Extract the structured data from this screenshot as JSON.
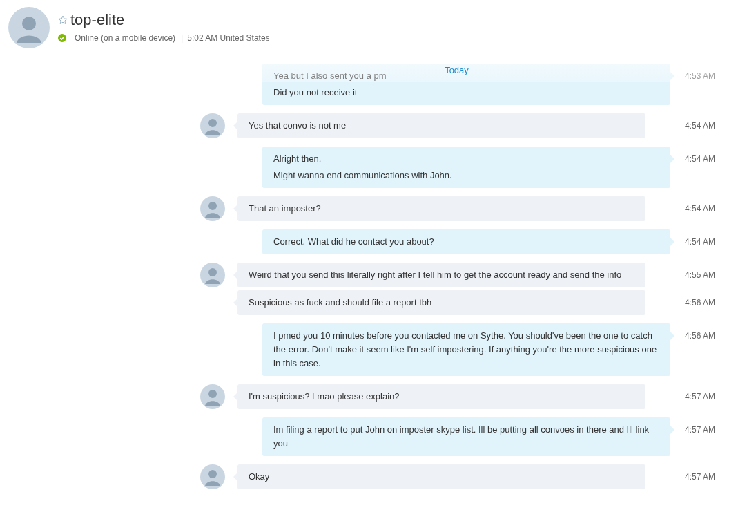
{
  "contact": {
    "name": "top-elite",
    "favorite": false,
    "online": true,
    "status": "Online (on a mobile device)",
    "separator": "|",
    "local_time": "5:02 AM United States"
  },
  "day_label": "Today",
  "messages": [
    {
      "kind": "outgoing",
      "show_avatar": false,
      "lines": [
        "Yea but I also sent you a pm",
        "Did you not receive it"
      ],
      "time": "4:53 AM"
    },
    {
      "kind": "incoming",
      "show_avatar": true,
      "lines": [
        "Yes that convo is not me"
      ],
      "time": "4:54 AM"
    },
    {
      "kind": "outgoing",
      "show_avatar": false,
      "lines": [
        "Alright then.",
        "Might wanna end communications with John."
      ],
      "time": "4:54 AM"
    },
    {
      "kind": "incoming",
      "show_avatar": true,
      "lines": [
        "That an imposter?"
      ],
      "time": "4:54 AM"
    },
    {
      "kind": "outgoing",
      "show_avatar": false,
      "lines": [
        "Correct. What did he contact you about?"
      ],
      "time": "4:54 AM"
    },
    {
      "kind": "incoming",
      "show_avatar": true,
      "lines": [
        "Weird that you send this literally right after I tell him to get the account ready and send the info"
      ],
      "time": "4:55 AM"
    },
    {
      "kind": "incoming",
      "show_avatar": false,
      "lines": [
        "Suspicious as fuck and should file a report tbh"
      ],
      "time": "4:56 AM"
    },
    {
      "kind": "outgoing",
      "show_avatar": false,
      "lines": [
        "I pmed you 10 minutes before you contacted me on Sythe. You should've been the one to catch the error. Don't make it seem like I'm self impostering. If anything you're the more suspicious one in this case."
      ],
      "time": "4:56 AM"
    },
    {
      "kind": "incoming",
      "show_avatar": true,
      "lines": [
        "I'm suspicious? Lmao please explain?"
      ],
      "time": "4:57 AM"
    },
    {
      "kind": "outgoing",
      "show_avatar": false,
      "lines": [
        "Im filing a report to put John on imposter skype list. Ill be putting all convoes in there and Ill link you"
      ],
      "time": "4:57 AM"
    },
    {
      "kind": "incoming",
      "show_avatar": true,
      "lines": [
        "Okay"
      ],
      "time": "4:57 AM"
    }
  ]
}
